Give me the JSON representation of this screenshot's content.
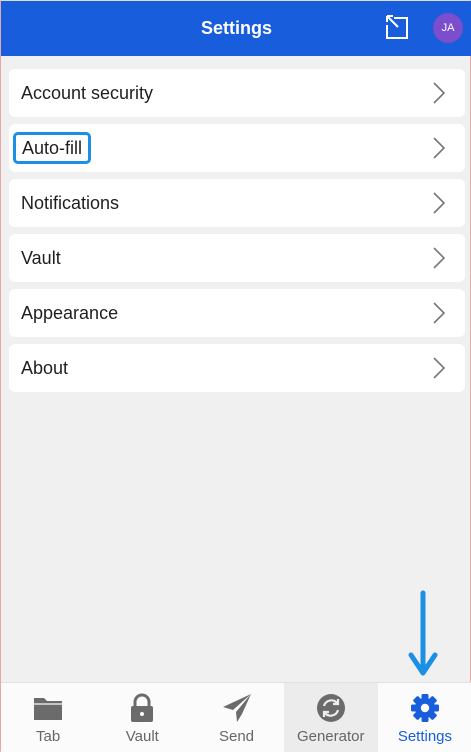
{
  "header": {
    "title": "Settings",
    "avatar_initials": "JA"
  },
  "settings_items": [
    {
      "label": "Account security"
    },
    {
      "label": "Auto-fill"
    },
    {
      "label": "Notifications"
    },
    {
      "label": "Vault"
    },
    {
      "label": "Appearance"
    },
    {
      "label": "About"
    }
  ],
  "tabs": [
    {
      "label": "Tab",
      "icon": "folder-icon"
    },
    {
      "label": "Vault",
      "icon": "lock-icon"
    },
    {
      "label": "Send",
      "icon": "paper-plane-icon"
    },
    {
      "label": "Generator",
      "icon": "refresh-icon"
    },
    {
      "label": "Settings",
      "icon": "gear-icon"
    }
  ],
  "colors": {
    "brand": "#175ddc",
    "focus_ring": "#1a8fe3",
    "annotation_arrow": "#1a8fe3",
    "avatar": "#7c4dcc"
  }
}
